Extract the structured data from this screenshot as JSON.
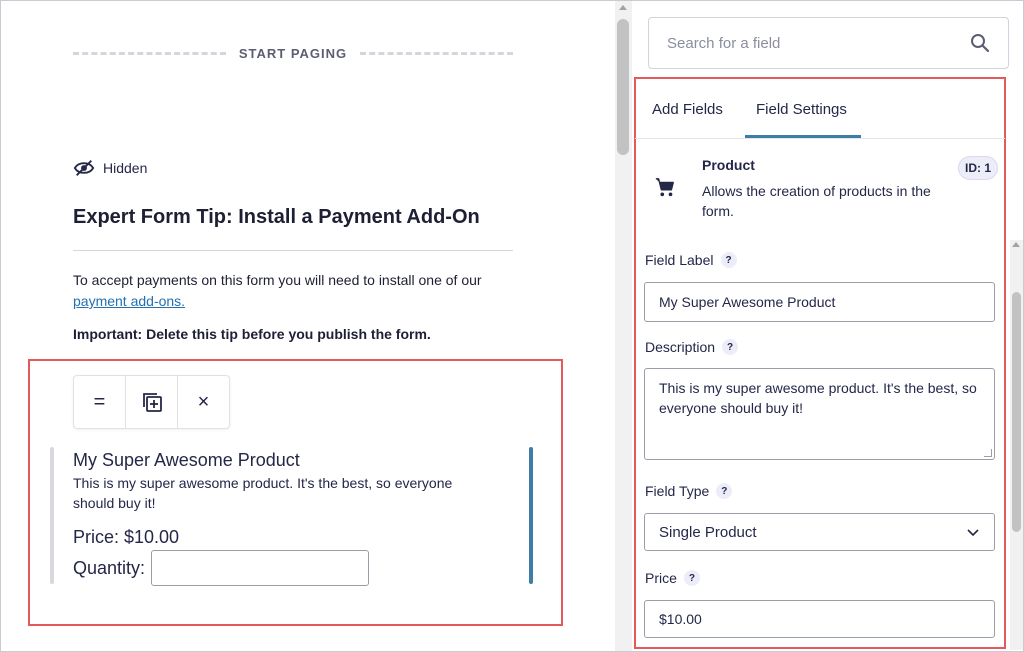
{
  "canvas": {
    "paging_label": "START PAGING",
    "hidden_label": "Hidden",
    "tip_title": "Expert Form Tip: Install a Payment Add-On",
    "tip_text": "To accept payments on this form you will need to install one of our",
    "tip_link": "payment add-ons.",
    "tip_important": "Important: Delete this tip before you publish the form.",
    "toolbar": {
      "move_icon": "=",
      "duplicate_icon": "duplicate-icon",
      "delete_icon": "×"
    },
    "product": {
      "name": "My Super Awesome Product",
      "description": "This is my super awesome product. It's the best, so everyone should buy it!",
      "price": "Price: $10.00",
      "quantity_label": "Quantity:",
      "quantity_value": ""
    }
  },
  "sidebar": {
    "search_placeholder": "Search for a field",
    "tabs": [
      {
        "label": "Add Fields",
        "active": false
      },
      {
        "label": "Field Settings",
        "active": true
      }
    ],
    "field_info": {
      "title": "Product",
      "description": "Allows the creation of products in the form.",
      "id_badge": "ID: 1",
      "icon": "cart-icon"
    },
    "field_label": {
      "label": "Field Label",
      "help": "?",
      "value": "My Super Awesome Product"
    },
    "description": {
      "label": "Description",
      "help": "?",
      "value": "This is my super awesome product. It's the best, so everyone should buy it!"
    },
    "field_type": {
      "label": "Field Type",
      "help": "?",
      "value": "Single Product"
    },
    "price": {
      "label": "Price",
      "help": "?",
      "value": "$10.00"
    }
  },
  "colors": {
    "accent": "#3e7da6",
    "highlight_box": "#e45a5a",
    "text": "#242748",
    "link": "#2271b1"
  }
}
